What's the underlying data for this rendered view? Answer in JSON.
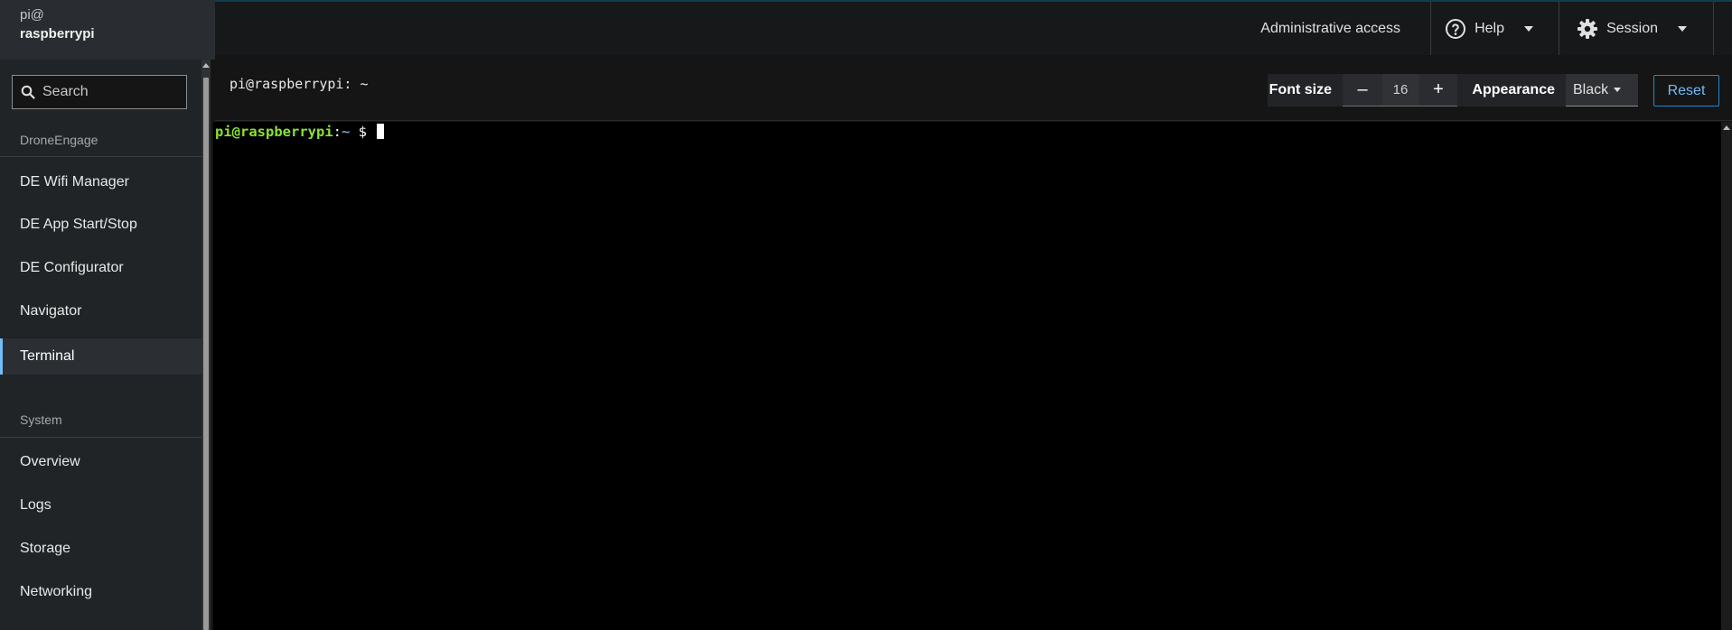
{
  "host": {
    "user": "pi@",
    "name": "raspberrypi"
  },
  "search": {
    "label": "Search"
  },
  "sidebar": {
    "sections": [
      {
        "title": "DroneEngage",
        "items": [
          "DE Wifi Manager",
          "DE App Start/Stop",
          "DE Configurator",
          "Navigator",
          "Terminal"
        ]
      },
      {
        "title": "System",
        "items": [
          "Overview",
          "Logs",
          "Storage",
          "Networking"
        ]
      }
    ],
    "active_item": "Terminal"
  },
  "topbar": {
    "admin_access": "Administrative access",
    "help": "Help",
    "session": "Session"
  },
  "terminal_toolbar": {
    "title": "pi@raspberrypi: ~",
    "font_size_label": "Font size",
    "minus": "–",
    "font_size_value": "16",
    "plus": "+",
    "appearance_label": "Appearance",
    "appearance_value": "Black",
    "reset_label": "Reset"
  },
  "terminal": {
    "prompt_user": "pi@raspberrypi",
    "prompt_sep": ":",
    "prompt_path": "~",
    "prompt_symbol": " $ "
  },
  "colors": {
    "accent": "#73bcf7",
    "reset_border": "#1f8ad0",
    "prompt_user": "#8ae234",
    "prompt_path": "#729fcf"
  },
  "icons": {
    "search": "search-icon",
    "help": "help-circle-icon",
    "session": "gear-icon"
  }
}
